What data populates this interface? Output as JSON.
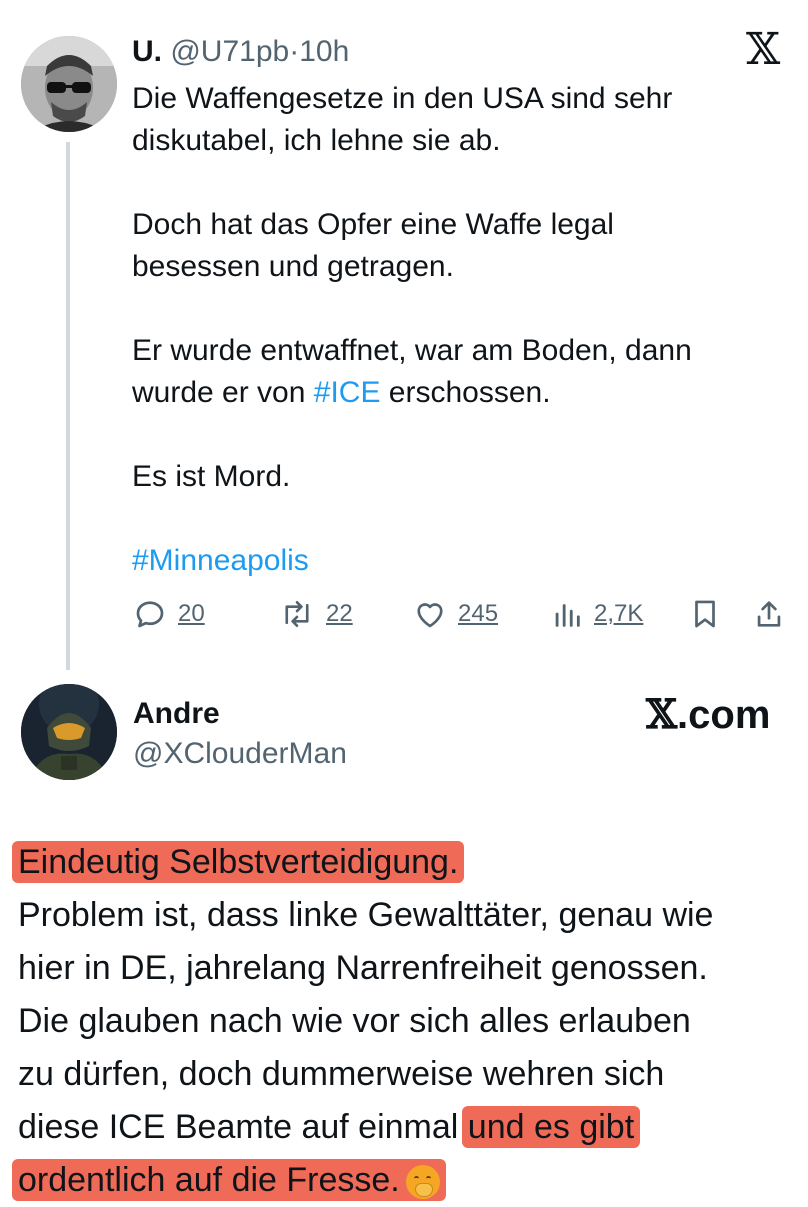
{
  "tweet": {
    "author_name": "U.",
    "author_handle": "@U71pb",
    "separator": "·",
    "time": "10h",
    "lines": [
      "Die Waffengesetze in den USA sind sehr",
      "diskutabel, ich lehne sie ab.",
      "Doch hat das Opfer eine Waffe legal",
      "besessen und getragen.",
      "Er wurde entwaffnet, war am Boden, dann"
    ],
    "line6_before": "wurde er von ",
    "line6_hashtag": "#ICE",
    "line6_after": " erschossen.",
    "line7": "Es ist Mord.",
    "hashtag_minneapolis": "#Minneapolis",
    "stats": {
      "replies": "20",
      "reposts": "22",
      "likes": "245",
      "views": "2,7K"
    }
  },
  "reply": {
    "author_name": "Andre",
    "author_handle": "@XClouderMan",
    "brand_x": "𝕏",
    "brand_suffix": ".com",
    "highlight1": "Eindeutig Selbstverteidigung.",
    "lines": [
      "Problem ist, dass linke Gewalttäter, genau wie",
      "hier in DE, jahrelang Narrenfreiheit genossen.",
      "Die glauben nach wie vor sich alles erlauben",
      "zu dürfen, doch dummerweise wehren sich"
    ],
    "line_last_plain": "diese ICE Beamte auf einmal ",
    "line_last_highlight": "und es gibt",
    "final_highlight": "ordentlich auf die Fresse.",
    "emoji_name": "face-with-hand-over-mouth-emoji"
  },
  "icons": {
    "close": "𝕏"
  },
  "colors": {
    "hashtag": "#1d9bf0",
    "muted": "#536471",
    "highlight": "#ef6b58",
    "thread_line": "#cfd9de"
  }
}
